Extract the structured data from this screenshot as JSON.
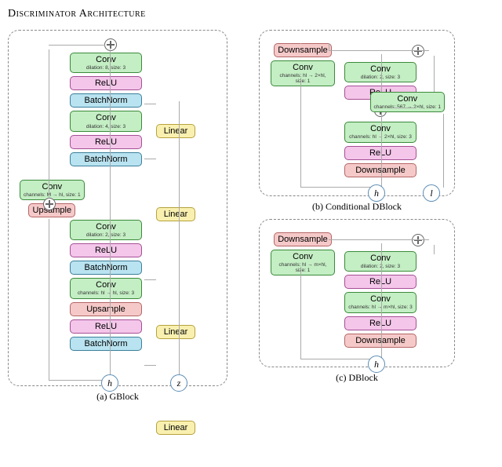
{
  "title": "Discriminator Architecture",
  "labels": {
    "conv": "Conv",
    "relu": "ReLU",
    "bn": "BatchNorm",
    "linear": "Linear",
    "upsample": "Upsample",
    "downsample": "Downsample"
  },
  "gblock": {
    "caption": "(a) GBlock",
    "conv_8_3": "dilation: 8, size: 3",
    "conv_4_3": "dilation: 4, size: 3",
    "conv_M_hl": "channels: M → hl, size: 1",
    "conv_2_3": "dilation: 2, size: 3",
    "conv_h_hl": "channels: hl → hl, size: 3",
    "pin_h": "h",
    "pin_z": "z"
  },
  "cond_dblock": {
    "caption": "(b) Conditional DBlock",
    "conv_side": "channels: hl → 2×hl, size: 1",
    "conv_top": "dilation: 2, size: 3",
    "conv_bot": "channels: hl → 2×hl, size: 3",
    "conv_branch": "channels: 567 → 2×hl, size: 1",
    "pin_h": "h",
    "pin_l": "l"
  },
  "dblock": {
    "caption": "(c) DBlock",
    "conv_side": "channels: hl → m×hl, size: 1",
    "conv_top": "dilation: 2, size: 3",
    "conv_bot": "channels: hl → m×hl, size: 3",
    "pin_h": "h"
  }
}
